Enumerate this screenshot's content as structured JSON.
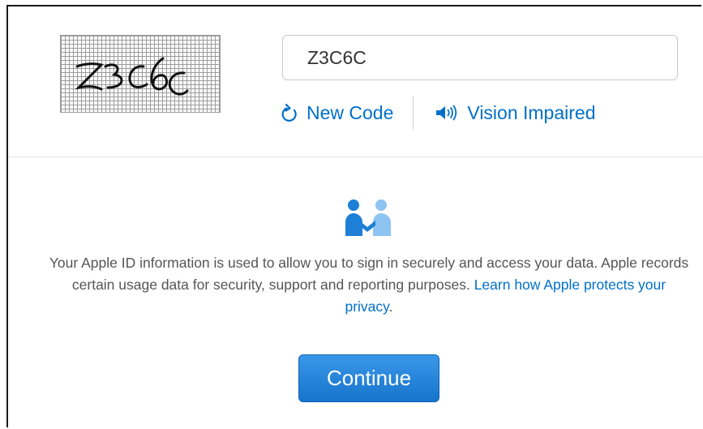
{
  "captcha": {
    "image_text": "Z3C6C",
    "input_value": "Z3C6C",
    "new_code_label": "New Code",
    "vision_impaired_label": "Vision Impaired",
    "refresh_icon": "refresh-icon",
    "speaker_icon": "speaker-icon"
  },
  "privacy": {
    "icon": "people-handshake-icon",
    "text": "Your Apple ID information is used to allow you to sign in securely and access your data. Apple records certain usage data for security, support and reporting purposes.",
    "link_label": "Learn how Apple protects your privacy",
    "trailing": "."
  },
  "actions": {
    "continue_label": "Continue"
  },
  "colors": {
    "link": "#0070c9",
    "button": "#1674cc",
    "text": "#555555"
  }
}
